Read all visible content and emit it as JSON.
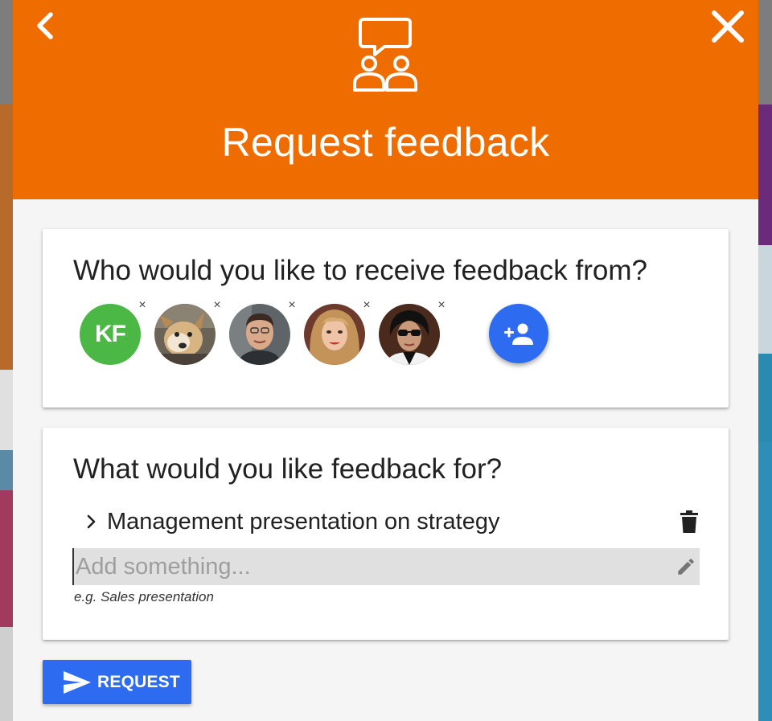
{
  "colors": {
    "header": "#ef6c00",
    "accent_blue": "#2d6cf0",
    "initials_green": "#4bb846"
  },
  "icons": {
    "back": "chevron-left-icon",
    "close": "close-icon",
    "header": "chat-group-icon",
    "add_person": "person-add-icon",
    "expand": "chevron-right-icon",
    "delete": "trash-icon",
    "edit": "pencil-icon",
    "send": "send-icon"
  },
  "header": {
    "title": "Request feedback"
  },
  "recipients_card": {
    "question": "Who would you like to receive feedback from?",
    "remove_symbol": "×",
    "recipients": [
      {
        "type": "initials",
        "initials": "KF"
      },
      {
        "type": "photo",
        "subject": "dog"
      },
      {
        "type": "photo",
        "subject": "man"
      },
      {
        "type": "photo",
        "subject": "woman"
      },
      {
        "type": "photo",
        "subject": "man-sunglasses"
      }
    ]
  },
  "feedback_card": {
    "question": "What would you like feedback for?",
    "items": [
      {
        "label": "Management presentation on strategy"
      }
    ],
    "input_placeholder": "Add something...",
    "input_value": "",
    "hint": "e.g. Sales presentation"
  },
  "footer": {
    "request_label": "REQUEST"
  }
}
